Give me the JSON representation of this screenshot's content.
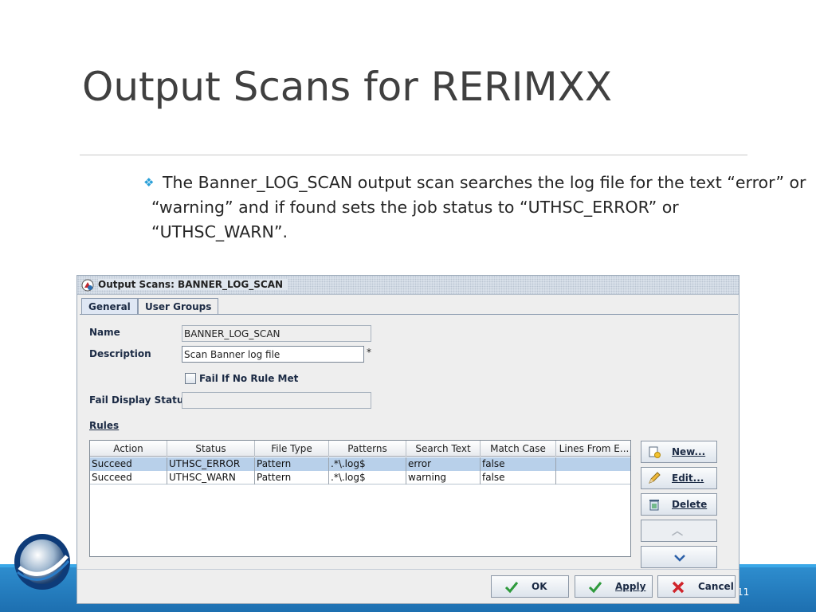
{
  "slide": {
    "title": "Output Scans for RERIMXX",
    "bullet": "The Banner_LOG_SCAN output scan searches the log file for the text “error” or “warning” and if found sets the job status to “UTHSC_ERROR” or “UTHSC_WARN”.",
    "page_number": "11"
  },
  "dialog": {
    "title": "Output Scans: BANNER_LOG_SCAN",
    "tabs": [
      {
        "label": "General",
        "active": true
      },
      {
        "label": "User Groups",
        "active": false
      }
    ],
    "fields": {
      "name_label": "Name",
      "name_value": "BANNER_LOG_SCAN",
      "description_label": "Description",
      "description_value": "Scan Banner log file",
      "required_marker": "*",
      "fail_if_no_rule_label": "Fail If No Rule Met",
      "fail_if_no_rule_checked": false,
      "fail_display_status_label": "Fail Display Status",
      "fail_display_status_value": "",
      "rules_label": "Rules"
    },
    "rules_table": {
      "columns": [
        "Action",
        "Status",
        "File Type",
        "Patterns",
        "Search Text",
        "Match Case",
        "Lines From E..."
      ],
      "rows": [
        {
          "cells": [
            "Succeed",
            "UTHSC_ERROR",
            "Pattern",
            ".*\\.log$",
            "error",
            "false",
            ""
          ],
          "selected": true
        },
        {
          "cells": [
            "Succeed",
            "UTHSC_WARN",
            "Pattern",
            ".*\\.log$",
            "warning",
            "false",
            ""
          ],
          "selected": false
        }
      ]
    },
    "side_buttons": {
      "new": "New...",
      "edit": "Edit...",
      "delete": "Delete"
    },
    "bottom_buttons": {
      "ok": "OK",
      "apply": "Apply",
      "cancel": "Cancel"
    }
  },
  "colors": {
    "footer_blue": "#1d6fb0",
    "bullet_accent": "#2aa0d8",
    "selected_row": "#b8d0ea"
  }
}
